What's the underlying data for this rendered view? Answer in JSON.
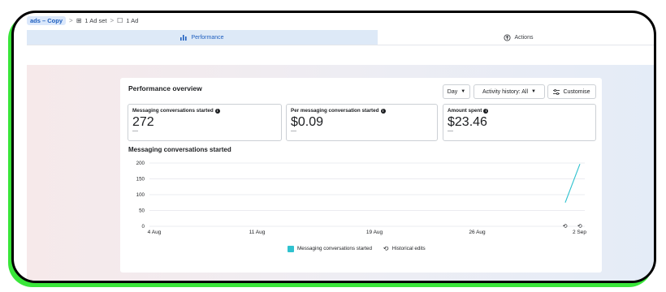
{
  "breadcrumb": {
    "campaign": "ads – Copy",
    "ad_set_icon": "grid-icon",
    "ad_set": "1 Ad set",
    "ad_icon": "square-icon",
    "ad": "1 Ad",
    "separator": ">"
  },
  "tabs": {
    "performance": {
      "label": "Performance",
      "icon": "bar-chart-icon"
    },
    "actions": {
      "label": "Actions",
      "icon": "arrow-up-circle-icon"
    }
  },
  "overview": {
    "title": "Performance overview",
    "day_select": "Day",
    "history_select": "Activity history: All",
    "customise_button": "Customise",
    "info_glyph": "i"
  },
  "metrics": [
    {
      "label": "Messaging conversations started",
      "value": "272",
      "delta": "—"
    },
    {
      "label": "Per messaging conversation started",
      "value": "$0.09",
      "delta": "—"
    },
    {
      "label": "Amount spent",
      "value": "$23.46",
      "delta": "—"
    }
  ],
  "chart_data": {
    "type": "line",
    "title": "Messaging conversations started",
    "y_ticks": [
      "200",
      "150",
      "100",
      "50",
      "0"
    ],
    "ylim": [
      0,
      200
    ],
    "x_ticks": [
      "4 Aug",
      "11 Aug",
      "19 Aug",
      "26 Aug",
      "2 Sep"
    ],
    "series": [
      {
        "name": "Messaging conversations started",
        "x": [
          "1 Sep",
          "2 Sep"
        ],
        "values": [
          75,
          197
        ],
        "color": "#2fc2cf"
      }
    ],
    "historical_edits_markers": [
      "1 Sep",
      "2 Sep"
    ],
    "grid": true,
    "legend_placement": "bottom-center"
  },
  "legend": {
    "series_label": "Messaging conversations started",
    "edits_label": "Historical edits"
  }
}
